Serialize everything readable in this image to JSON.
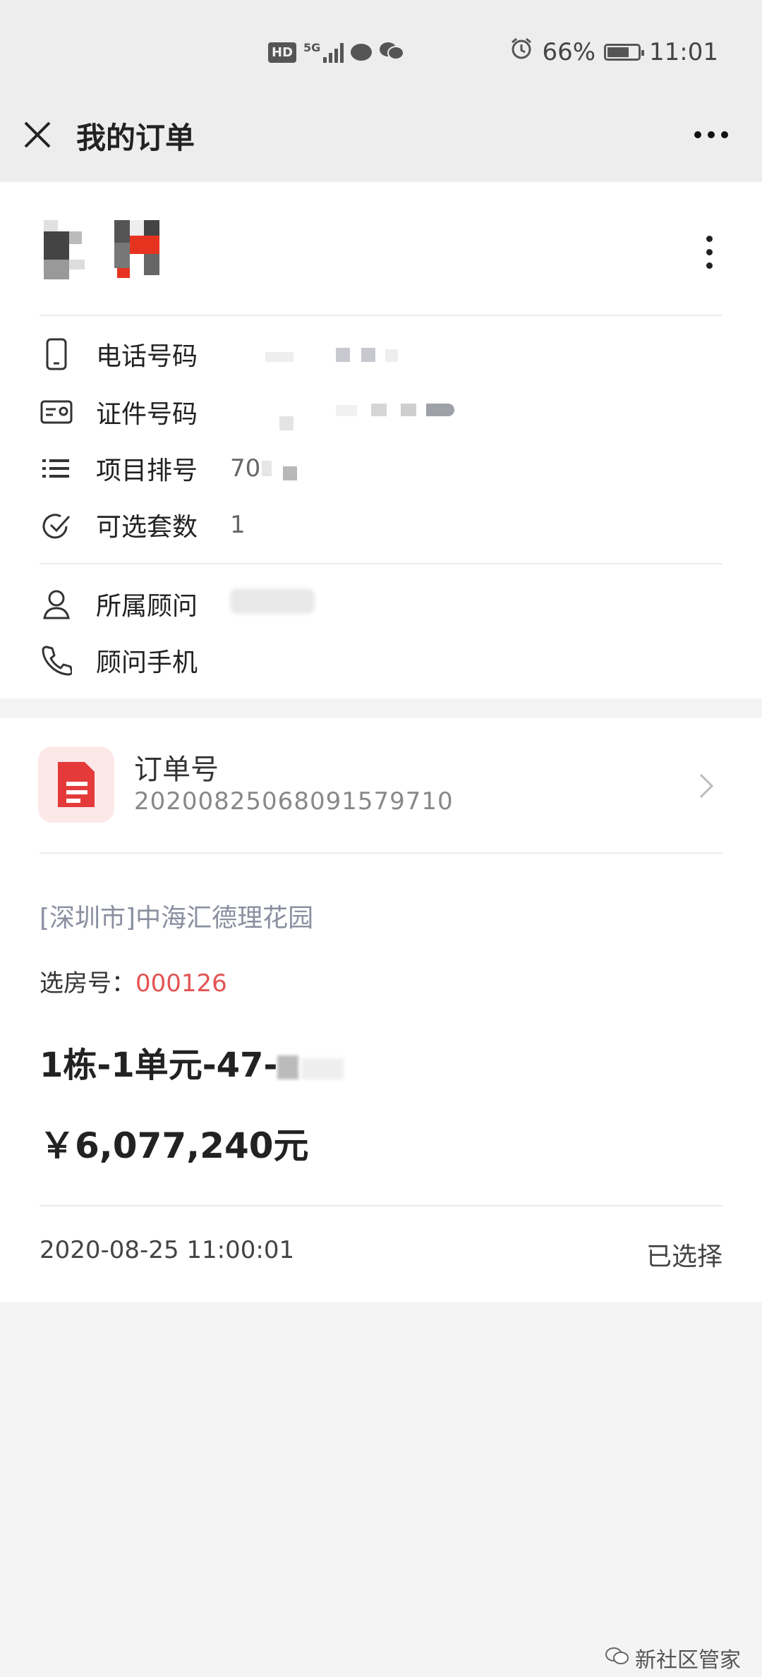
{
  "status_bar": {
    "battery": "66%",
    "time": "11:01",
    "network": "5G",
    "hd": "HD"
  },
  "header": {
    "title": "我的订单"
  },
  "customer": {
    "rows": [
      {
        "icon": "phone-icon",
        "label": "电话号码",
        "value": ""
      },
      {
        "icon": "id-card-icon",
        "label": "证件号码",
        "value": ""
      },
      {
        "icon": "list-icon",
        "label": "项目排号",
        "value": "70"
      },
      {
        "icon": "check-icon",
        "label": "可选套数",
        "value": "1"
      }
    ],
    "advisor_rows": [
      {
        "icon": "person-icon",
        "label": "所属顾问",
        "value": ""
      },
      {
        "icon": "phone-handset-icon",
        "label": "顾问手机",
        "value": ""
      }
    ]
  },
  "order": {
    "label": "订单号",
    "number": "20200825068091579710",
    "project": "[深圳市]中海汇德理花园",
    "room_label": "选房号：",
    "room_number": "000126",
    "unit": "1栋-1单元-47-",
    "price": "￥6,077,240元",
    "time": "2020-08-25 11:00:01",
    "status": "已选择"
  },
  "watermark": "新社区管家"
}
